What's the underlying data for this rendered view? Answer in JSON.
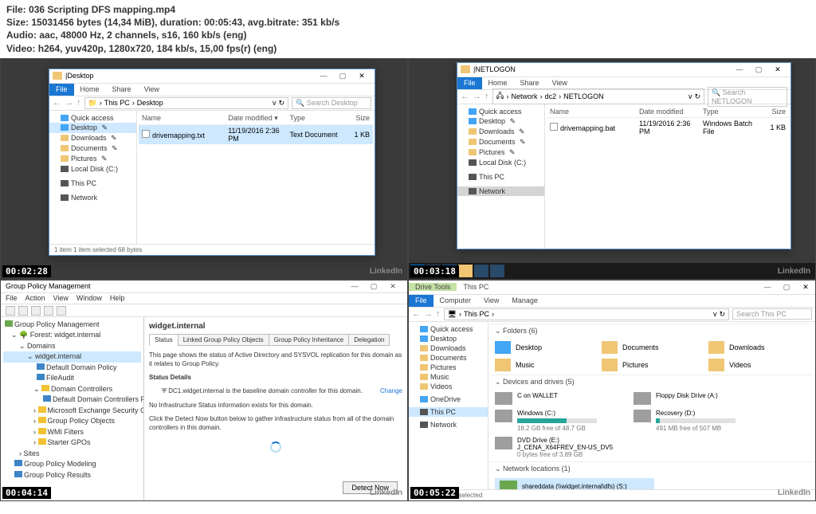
{
  "header": {
    "file_label": "File:",
    "file_name": "036 Scripting DFS mapping.mp4",
    "size_label": "Size:",
    "size_value": "15031456 bytes (14,34 MiB), duration: 00:05:43, avg.bitrate: 351 kb/s",
    "audio_label": "Audio:",
    "audio_value": "aac, 48000 Hz, 2 channels, s16, 160 kb/s (eng)",
    "video_label": "Video:",
    "video_value": "h264, yuv420p, 1280x720, 184 kb/s, 15,00 fps(r) (eng)"
  },
  "timestamps": {
    "tl": "00:02:28",
    "tr": "00:03:18",
    "bl": "00:04:14",
    "br": "00:05:22"
  },
  "watermark": "LinkedIn",
  "explorer_common": {
    "file": "File",
    "home": "Home",
    "share": "Share",
    "view": "View",
    "drive_tools": "Drive Tools",
    "computer": "Computer",
    "manage": "Manage",
    "name": "Name",
    "date_mod": "Date modified",
    "type": "Type",
    "size": "Size",
    "quick_access": "Quick access",
    "desktop": "Desktop",
    "downloads": "Downloads",
    "documents": "Documents",
    "pictures": "Pictures",
    "local_disk": "Local Disk (C:)",
    "music": "Music",
    "videos": "Videos",
    "this_pc": "This PC",
    "network": "Network",
    "onedrive": "OneDrive"
  },
  "panel_tl": {
    "title": "Desktop",
    "path": [
      "This PC",
      "Desktop"
    ],
    "search_ph": "Search Desktop",
    "file": {
      "name": "drivemapping.txt",
      "date": "11/19/2016 2:36 PM",
      "type": "Text Document",
      "size": "1 KB"
    },
    "status": "1 item    1 item selected  68 bytes"
  },
  "panel_tr": {
    "title": "NETLOGON",
    "path": [
      "Network",
      "dc2",
      "NETLOGON"
    ],
    "search_ph": "Search NETLOGON",
    "file": {
      "name": "drivemapping.bat",
      "date": "11/19/2016 2:36 PM",
      "type": "Windows Batch File",
      "size": "1 KB"
    }
  },
  "panel_bl": {
    "title": "Group Policy Management",
    "menu": [
      "File",
      "Action",
      "View",
      "Window",
      "Help"
    ],
    "tree": {
      "root": "Group Policy Management",
      "forest": "Forest: widget.internal",
      "domains": "Domains",
      "domain": "widget.internal",
      "items": [
        "Default Domain Policy",
        "FileAudit",
        "Domain Controllers",
        "Default Domain Controllers Pol",
        "Microsoft Exchange Security Group",
        "Group Policy Objects",
        "WMI Filters",
        "Starter GPOs"
      ],
      "sites": "Sites",
      "modeling": "Group Policy Modeling",
      "results": "Group Policy Results"
    },
    "detail": {
      "heading": "widget.internal",
      "tabs": [
        "Status",
        "Linked Group Policy Objects",
        "Group Policy Inheritance",
        "Delegation"
      ],
      "intro": "This page shows the status of Active Directory and SYSVOL replication for this domain as it relates to Group Policy.",
      "status_details": "Status Details",
      "baseline": "DC1.widget.internal is the baseline domain controller for this domain.",
      "change": "Change",
      "noinfo": "No Infrastructure Status information exists for this domain.",
      "click_detect": "Click the Detect Now button below to gather infrastructure status from all of the domain controllers in this domain.",
      "detect": "Detect Now"
    }
  },
  "panel_br": {
    "title": "This PC",
    "path": [
      "This PC"
    ],
    "search_ph": "Search This PC",
    "folders_h": "Folders (6)",
    "devices_h": "Devices and drives (5)",
    "network_h": "Network locations (1)",
    "drives": {
      "wallet": {
        "name": "C on WALLET"
      },
      "floppy": {
        "name": "Floppy Disk Drive (A:)"
      },
      "windows": {
        "name": "Windows (C:)",
        "free": "18.2 GB free of 48.7 GB"
      },
      "recovery": {
        "name": "Recovery (D:)",
        "free": "491 MB free of 507 MB"
      },
      "dvd": {
        "name": "DVD Drive (E:)",
        "label": "J_CENA_X64FREV_EN-US_DV5",
        "free": "0 bytes free of 3.89 GB"
      }
    },
    "netloc": {
      "name": "shareddata (\\\\widget.internal\\dfs) (S:)"
    },
    "status": "12 items    1 item selected"
  }
}
